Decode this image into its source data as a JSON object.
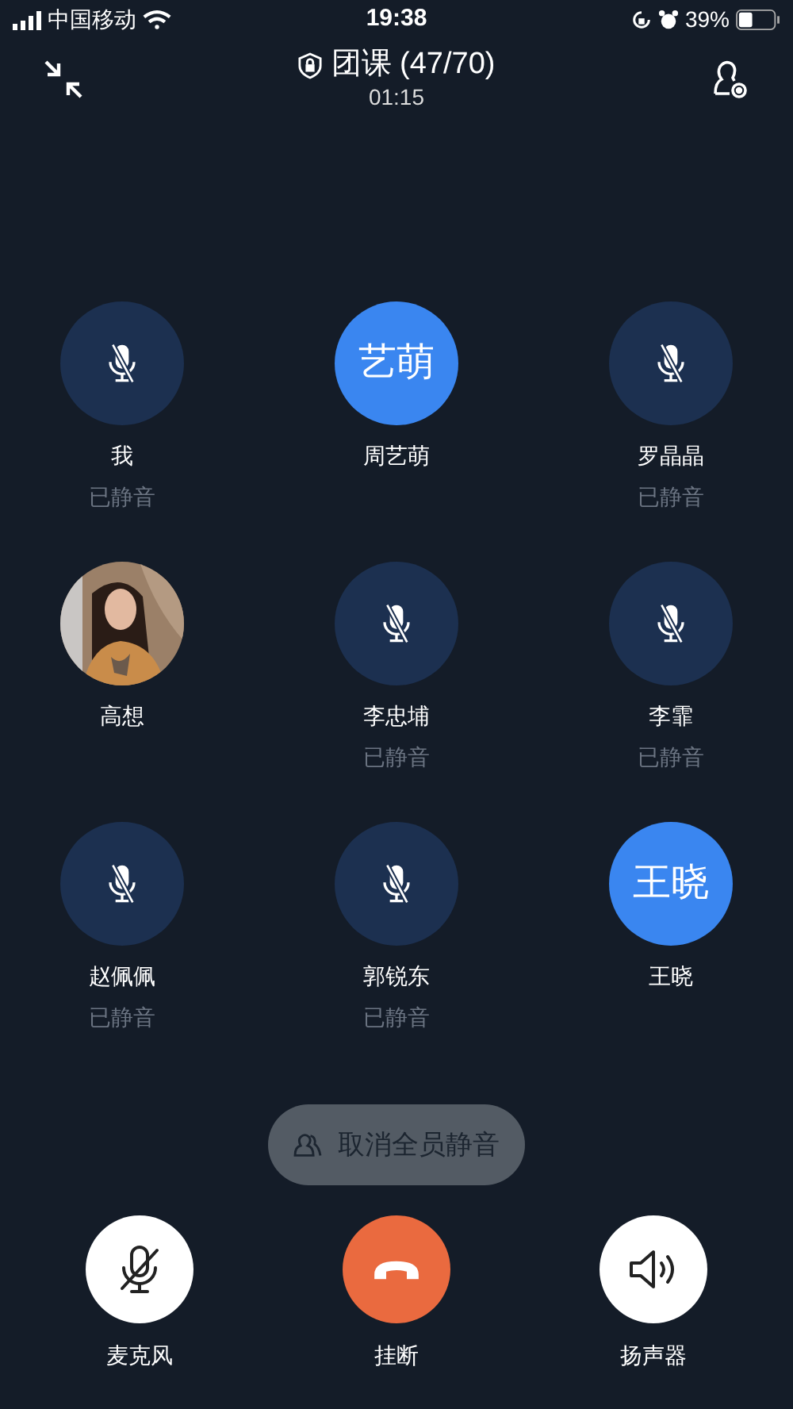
{
  "status_bar": {
    "carrier": "中国移动",
    "time": "19:38",
    "battery": "39%"
  },
  "header": {
    "title": "团课 (47/70)",
    "duration": "01:15"
  },
  "participants": [
    {
      "kind": "muted",
      "name": "我",
      "status": "已静音"
    },
    {
      "kind": "speaking",
      "avatar_text": "艺萌",
      "name": "周艺萌"
    },
    {
      "kind": "muted",
      "name": "罗晶晶",
      "status": "已静音"
    },
    {
      "name": "高想"
    },
    {
      "kind": "muted",
      "name": "李忠埔",
      "status": "已静音"
    },
    {
      "kind": "muted",
      "name": "李霏",
      "status": "已静音"
    },
    {
      "kind": "muted",
      "name": "赵佩佩",
      "status": "已静音"
    },
    {
      "kind": "muted",
      "name": "郭锐东",
      "status": "已静音"
    },
    {
      "kind": "speaking",
      "avatar_text": "王晓",
      "name": "王晓"
    }
  ],
  "unmute_all_button": {
    "label": "取消全员静音"
  },
  "controls": [
    {
      "kind": "microphone",
      "label": "麦克风"
    },
    {
      "kind": "hangup",
      "label": "挂断"
    },
    {
      "kind": "speaker",
      "label": "扬声器"
    }
  ]
}
